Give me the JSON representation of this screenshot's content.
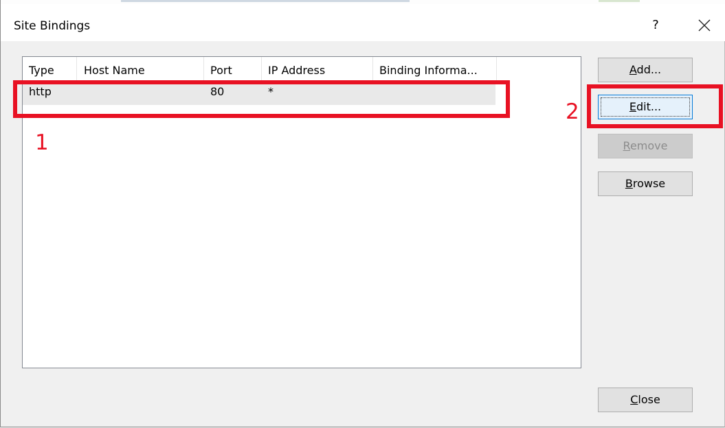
{
  "window": {
    "title": "Site Bindings",
    "help_label": "?"
  },
  "table": {
    "columns": [
      "Type",
      "Host Name",
      "Port",
      "IP Address",
      "Binding Informa..."
    ],
    "rows": [
      {
        "type": "http",
        "host_name": "",
        "port": "80",
        "ip_address": "*",
        "binding_info": ""
      }
    ]
  },
  "buttons": {
    "add": {
      "mnemonic": "A",
      "rest": "dd...",
      "state": "enabled"
    },
    "edit": {
      "mnemonic": "E",
      "rest": "dit...",
      "state": "focused"
    },
    "remove": {
      "mnemonic": "R",
      "rest": "emove",
      "state": "disabled"
    },
    "browse": {
      "mnemonic": "B",
      "rest": "rowse",
      "state": "enabled"
    },
    "close": {
      "mnemonic": "C",
      "rest": "lose",
      "state": "enabled"
    }
  },
  "annotations": {
    "one": "1",
    "two": "2",
    "color": "#e81123"
  },
  "icons": {
    "help": "question-mark",
    "close": "close-x"
  }
}
